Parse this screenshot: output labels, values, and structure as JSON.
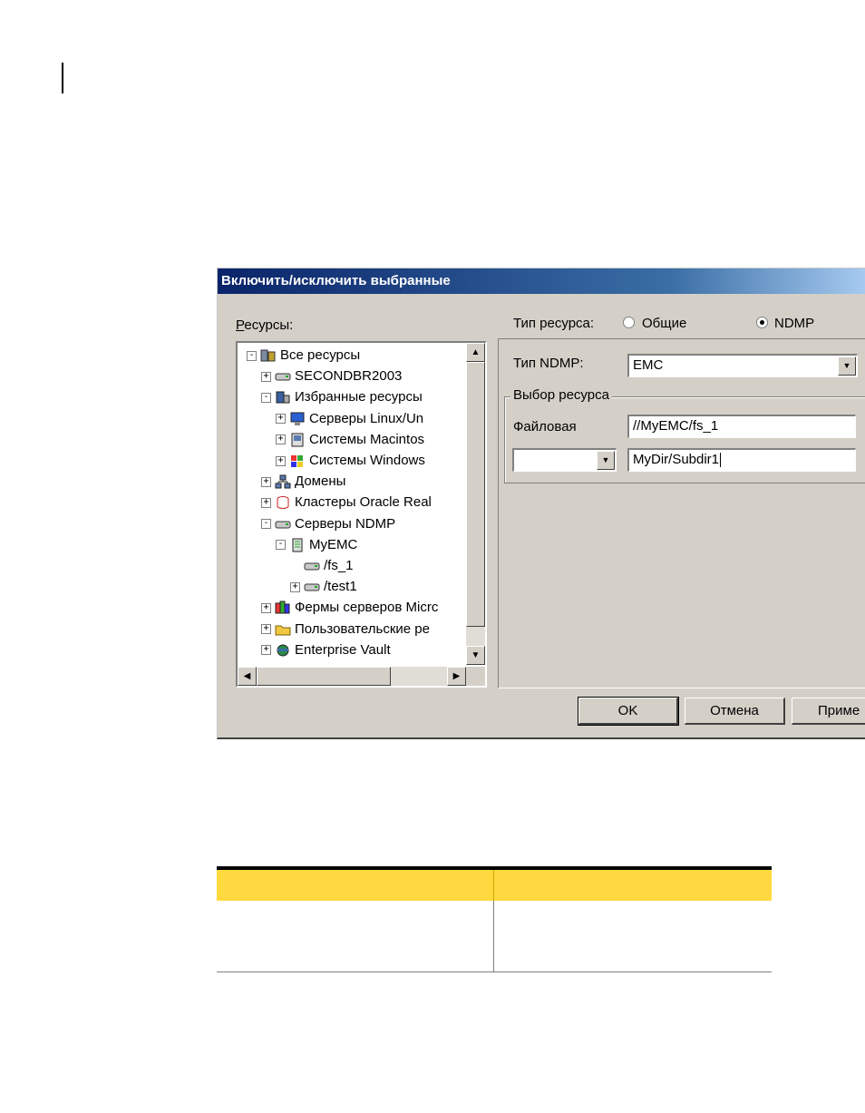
{
  "dialog": {
    "title": "Включить/исключить выбранные",
    "resources_label": "Ресурсы:",
    "tree": [
      {
        "label": "Все ресурсы",
        "depth": 0,
        "expander": "-",
        "icon": "all-resources-icon"
      },
      {
        "label": "SECONDBR2003",
        "depth": 1,
        "expander": "+",
        "icon": "drive-icon"
      },
      {
        "label": "Избранные ресурсы",
        "depth": 1,
        "expander": "-",
        "icon": "favorites-icon"
      },
      {
        "label": "Серверы Linux/Un",
        "depth": 2,
        "expander": "+",
        "icon": "monitor-icon"
      },
      {
        "label": "Системы Macintos",
        "depth": 2,
        "expander": "+",
        "icon": "mac-icon"
      },
      {
        "label": "Системы Windows",
        "depth": 2,
        "expander": "+",
        "icon": "windows-icon"
      },
      {
        "label": "Домены",
        "depth": 1,
        "expander": "+",
        "icon": "network-icon"
      },
      {
        "label": "Кластеры Oracle Real",
        "depth": 1,
        "expander": "+",
        "icon": "database-icon"
      },
      {
        "label": "Серверы NDMP",
        "depth": 1,
        "expander": "-",
        "icon": "drive-icon"
      },
      {
        "label": "MyEMC",
        "depth": 2,
        "expander": "-",
        "icon": "server-icon"
      },
      {
        "label": "/fs_1",
        "depth": 3,
        "expander": "",
        "icon": "drive-icon"
      },
      {
        "label": "/test1",
        "depth": 3,
        "expander": "+",
        "icon": "drive-icon"
      },
      {
        "label": "Фермы серверов Micrc",
        "depth": 1,
        "expander": "+",
        "icon": "farm-icon"
      },
      {
        "label": "Пользовательские ре",
        "depth": 1,
        "expander": "+",
        "icon": "folder-icon"
      },
      {
        "label": "Enterprise Vault",
        "depth": 1,
        "expander": "+",
        "icon": "vault-icon"
      }
    ],
    "resource_type_label": "Тип ресурса:",
    "radio_common_label": "Общие",
    "radio_ndmp_label": "NDMP",
    "ndmp_type_label": "Тип NDMP:",
    "ndmp_type_value": "EMC",
    "resource_selection_legend": "Выбор ресурса",
    "file_label": "Файловая",
    "file_value": "//MyEMC/fs_1",
    "path_value": "MyDir/Subdir1",
    "ok_label": "OK",
    "cancel_label": "Отмена",
    "apply_label": "Приме"
  },
  "colors": {
    "table_header": "#ffd93f",
    "dialog_face": "#d4d0c8",
    "title_start": "#0a246a"
  }
}
